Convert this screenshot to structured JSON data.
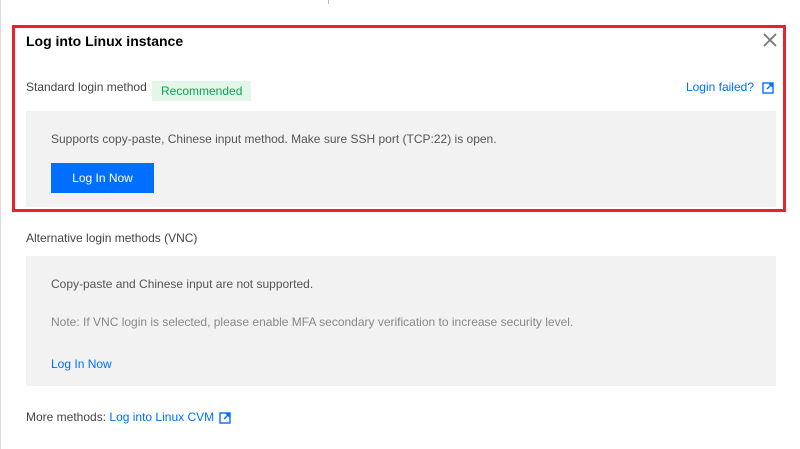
{
  "dialog": {
    "title": "Log into Linux instance"
  },
  "standard": {
    "label": "Standard login method",
    "badge": "Recommended",
    "failed_link": "Login failed?",
    "description": "Supports copy-paste, Chinese input method. Make sure SSH port (TCP:22) is open.",
    "login_button": "Log In Now"
  },
  "vnc": {
    "label": "Alternative login methods (VNC)",
    "description": "Copy-paste and Chinese input are not supported.",
    "note": "Note: If VNC login is selected, please enable MFA secondary verification to increase security level.",
    "login_link": "Log In Now"
  },
  "more": {
    "prefix": "More methods:",
    "link": "Log into Linux CVM"
  },
  "colors": {
    "accent": "#006eff",
    "highlight_border": "#e7232b",
    "badge_bg": "#e4f6ea",
    "badge_text": "#0aa34f",
    "panel_bg": "#f2f2f2"
  },
  "icons": {
    "close": "close-icon",
    "external": "external-link-icon"
  }
}
